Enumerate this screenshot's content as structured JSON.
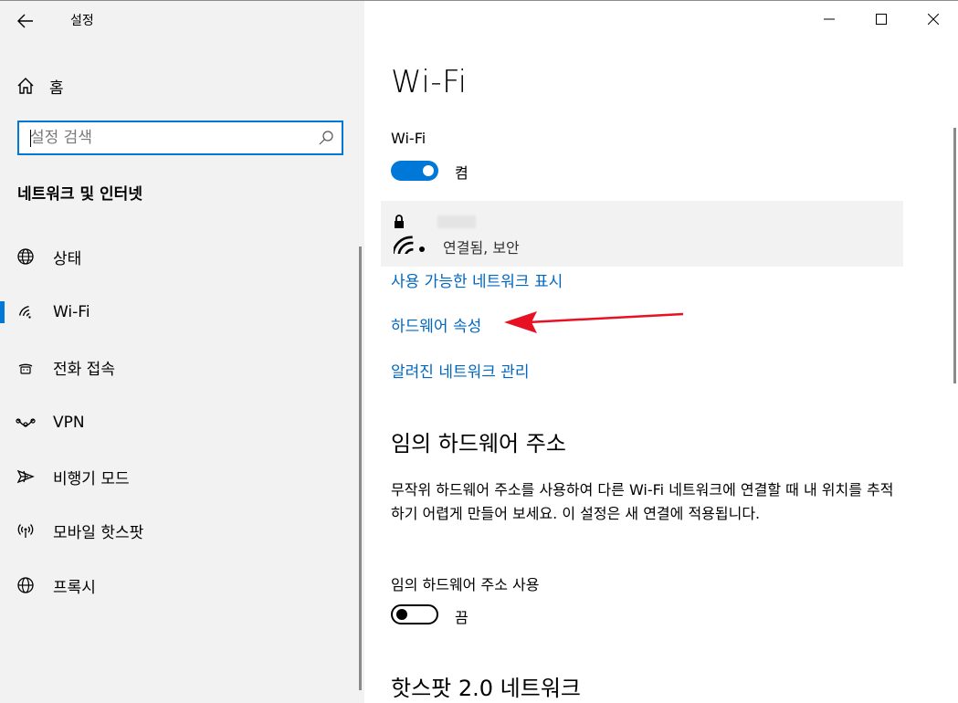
{
  "window": {
    "title": "설정",
    "controls": {
      "minimize": "—",
      "maximize": "☐",
      "close": "✕"
    }
  },
  "sidebar": {
    "home_label": "홈",
    "search_placeholder": "설정 검색",
    "search_value": "",
    "section_title": "네트워크 및 인터넷",
    "items": [
      {
        "label": "상태",
        "icon": "globe-status-icon",
        "active": false
      },
      {
        "label": "Wi-Fi",
        "icon": "wifi-icon",
        "active": true
      },
      {
        "label": "전화 접속",
        "icon": "dialup-icon",
        "active": false
      },
      {
        "label": "VPN",
        "icon": "vpn-icon",
        "active": false
      },
      {
        "label": "비행기 모드",
        "icon": "airplane-icon",
        "active": false
      },
      {
        "label": "모바일 핫스팟",
        "icon": "hotspot-icon",
        "active": false
      },
      {
        "label": "프록시",
        "icon": "globe-icon",
        "active": false
      }
    ]
  },
  "main": {
    "title": "Wi-Fi",
    "wifi_label": "Wi-Fi",
    "wifi_toggle": {
      "state": "on",
      "text": "켬"
    },
    "network": {
      "name": "",
      "status": "연결됨, 보안"
    },
    "links": {
      "show_available": "사용 가능한 네트워크 표시",
      "hardware_props": "하드웨어 속성",
      "manage_known": "알려진 네트워크 관리"
    },
    "random_hw": {
      "heading": "임의 하드웨어 주소",
      "description": "무작위 하드웨어 주소를 사용하여 다른 Wi-Fi 네트워크에 연결할 때 내 위치를 추적하기 어렵게 만들어 보세요. 이 설정은 새 연결에 적용됩니다.",
      "toggle_label": "임의 하드웨어 주소 사용",
      "toggle": {
        "state": "off",
        "text": "끔"
      }
    },
    "hotspot_heading": "핫스팟 2.0 네트워크"
  },
  "colors": {
    "accent": "#0078d7",
    "link": "#0067c0",
    "annotation_arrow": "#e81123",
    "sidebar_bg": "#f2f2f2"
  }
}
